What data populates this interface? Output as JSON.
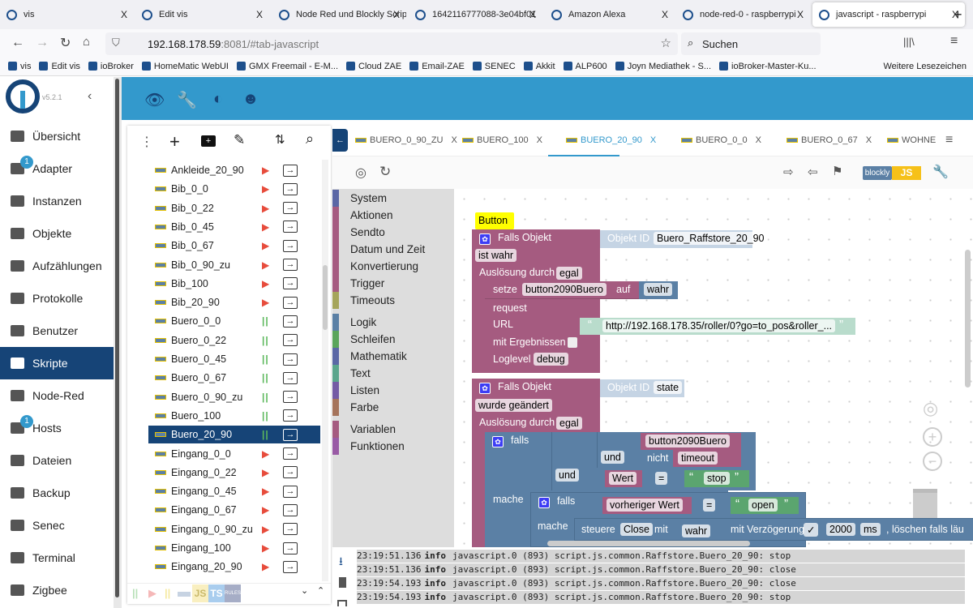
{
  "browser": {
    "tabs": [
      {
        "title": "vis"
      },
      {
        "title": "Edit vis"
      },
      {
        "title": "Node Red und Blockly Scrip"
      },
      {
        "title": "1642116777088-3e04bf01"
      },
      {
        "title": "Amazon Alexa"
      },
      {
        "title": "node-red-0 - raspberrypi"
      },
      {
        "title": "javascript - raspberrypi",
        "active": true
      }
    ],
    "close": "X",
    "newtab": "+",
    "url_host": "192.168.178.59",
    "url_rest": ":8081/#tab-javascript",
    "search_placeholder": "Suchen",
    "bookmarks": [
      "vis",
      "Edit vis",
      "ioBroker",
      "HomeMatic WebUI",
      "GMX Freemail - E-M...",
      "Cloud ZAE",
      "Email-ZAE",
      "SENEC",
      "Akkit",
      "ALP600",
      "Joyn Mediathek - S...",
      "ioBroker-Master-Ku..."
    ],
    "more_bookmarks": "Weitere Lesezeichen"
  },
  "app": {
    "version": "v5.2.1",
    "sidebar": [
      {
        "label": "Übersicht"
      },
      {
        "label": "Adapter",
        "badge": "1"
      },
      {
        "label": "Instanzen"
      },
      {
        "label": "Objekte"
      },
      {
        "label": "Aufzählungen"
      },
      {
        "label": "Protokolle"
      },
      {
        "label": "Benutzer"
      },
      {
        "label": "Skripte",
        "active": true
      },
      {
        "label": "Node-Red"
      },
      {
        "label": "Hosts",
        "badge": "1"
      },
      {
        "label": "Dateien"
      },
      {
        "label": "Backup"
      },
      {
        "label": "Senec"
      },
      {
        "label": "Terminal"
      },
      {
        "label": "Zigbee"
      }
    ],
    "accent": "#3399cc",
    "active_bg": "#164477"
  },
  "scripts": [
    {
      "name": "Ankleide_20_90",
      "state": "stopped"
    },
    {
      "name": "Bib_0_0",
      "state": "stopped"
    },
    {
      "name": "Bib_0_22",
      "state": "stopped"
    },
    {
      "name": "Bib_0_45",
      "state": "stopped"
    },
    {
      "name": "Bib_0_67",
      "state": "stopped"
    },
    {
      "name": "Bib_0_90_zu",
      "state": "stopped"
    },
    {
      "name": "Bib_100",
      "state": "stopped"
    },
    {
      "name": "Bib_20_90",
      "state": "stopped"
    },
    {
      "name": "Buero_0_0",
      "state": "running"
    },
    {
      "name": "Buero_0_22",
      "state": "running"
    },
    {
      "name": "Buero_0_45",
      "state": "running"
    },
    {
      "name": "Buero_0_67",
      "state": "running"
    },
    {
      "name": "Buero_0_90_zu",
      "state": "running"
    },
    {
      "name": "Buero_100",
      "state": "running"
    },
    {
      "name": "Buero_20_90",
      "state": "running",
      "selected": true
    },
    {
      "name": "Eingang_0_0",
      "state": "stopped"
    },
    {
      "name": "Eingang_0_22",
      "state": "stopped"
    },
    {
      "name": "Eingang_0_45",
      "state": "stopped"
    },
    {
      "name": "Eingang_0_67",
      "state": "stopped"
    },
    {
      "name": "Eingang_0_90_zu",
      "state": "stopped"
    },
    {
      "name": "Eingang_100",
      "state": "stopped"
    },
    {
      "name": "Eingang_20_90",
      "state": "stopped"
    }
  ],
  "filters": {
    "js": "JS",
    "ts": "TS",
    "rules": "RULES"
  },
  "editor": {
    "tabs": [
      {
        "label": "BUERO_0_90_ZU"
      },
      {
        "label": "BUERO_100"
      },
      {
        "label": "BUERO_20_90",
        "active": true
      },
      {
        "label": "BUERO_0_0"
      },
      {
        "label": "BUERO_0_67"
      },
      {
        "label": "WOHNE"
      }
    ],
    "mode_blockly": "blockly",
    "mode_js": "JS",
    "toolbox": [
      {
        "label": "System",
        "color": "#5b67a5"
      },
      {
        "label": "Aktionen",
        "color": "#a55b80"
      },
      {
        "label": "Sendto",
        "color": "#a55b80"
      },
      {
        "label": "Datum und Zeit",
        "color": "#a55b80"
      },
      {
        "label": "Konvertierung",
        "color": "#a55b80"
      },
      {
        "label": "Trigger",
        "color": "#a55b80"
      },
      {
        "label": "Timeouts",
        "color": "#a5a55b"
      },
      {
        "label": "Logik",
        "color": "#5b80a5"
      },
      {
        "label": "Schleifen",
        "color": "#5ba55b"
      },
      {
        "label": "Mathematik",
        "color": "#5b67a5"
      },
      {
        "label": "Text",
        "color": "#5ba58c"
      },
      {
        "label": "Listen",
        "color": "#745ba5"
      },
      {
        "label": "Farbe",
        "color": "#a5745b"
      },
      {
        "label": "Variablen",
        "color": "#a55b80"
      },
      {
        "label": "Funktionen",
        "color": "#995ba5"
      }
    ],
    "blocks": {
      "comment": "Button",
      "falls_objekt": "Falls Objekt",
      "objekt_id": "Objekt ID",
      "id1": "Buero_Raffstore_20_90",
      "ist_wahr": "ist wahr",
      "ausloesung": "Auslösung durch",
      "egal": "egal",
      "setze": "setze",
      "var1": "button2090Buero",
      "auf": "auf",
      "wahr": "wahr",
      "request": "request",
      "url": "URL",
      "url_value": "http://192.168.178.35/roller/0?go=to_pos&roller_...",
      "mit_ergebnissen": "mit Ergebnissen",
      "loglevel": "Loglevel",
      "debug": "debug",
      "id2": "state",
      "wurde_geaendert": "wurde geändert",
      "falls": "falls",
      "und": "und",
      "nicht": "nicht",
      "timeout": "timeout",
      "wert": "Wert",
      "eq": "=",
      "stop": "stop",
      "mache": "mache",
      "vorheriger_wert": "vorheriger Wert",
      "open": "open",
      "steuere": "steuere",
      "close_var": "Close",
      "mit": "mit",
      "mit_verzoegerung": "mit Verzögerung",
      "check": "✓",
      "delay": "2000",
      "ms": "ms",
      "loeschen": ", löschen falls läu"
    }
  },
  "log": [
    {
      "time": "23:19:51.136",
      "level": "info",
      "msg": "javascript.0 (893) script.js.common.Raffstore.Buero_20_90: stop"
    },
    {
      "time": "23:19:51.136",
      "level": "info",
      "msg": "javascript.0 (893) script.js.common.Raffstore.Buero_20_90: close"
    },
    {
      "time": "23:19:54.193",
      "level": "info",
      "msg": "javascript.0 (893) script.js.common.Raffstore.Buero_20_90: close"
    },
    {
      "time": "23:19:54.193",
      "level": "info",
      "msg": "javascript.0 (893) script.js.common.Raffstore.Buero_20_90: stop"
    }
  ]
}
